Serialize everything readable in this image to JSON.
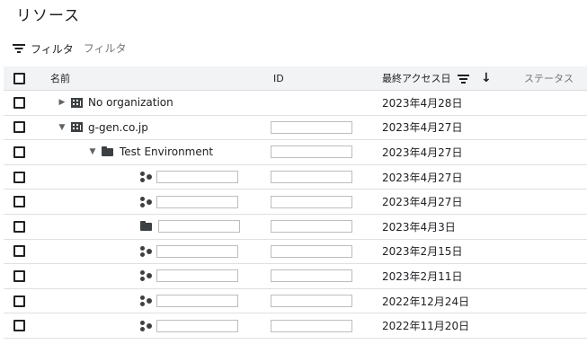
{
  "page": {
    "title": "リソース"
  },
  "filter": {
    "icon": "filter-icon",
    "label": "フィルタ",
    "placeholder": "フィルタ"
  },
  "table": {
    "columns": {
      "name": "名前",
      "id": "ID",
      "last_access": "最終アクセス日",
      "status": "ステータス"
    },
    "sort": {
      "column": "last_access",
      "direction": "descending"
    },
    "rows": [
      {
        "type": "organization",
        "name": "No organization",
        "id": "",
        "last_access": "2023年4月28日",
        "expanded": false
      },
      {
        "type": "organization",
        "name": "g-gen.co.jp",
        "id": "",
        "last_access": "2023年4月27日",
        "expanded": true
      },
      {
        "type": "folder",
        "name": "Test Environment",
        "id": "",
        "last_access": "2023年4月27日",
        "expanded": true
      },
      {
        "type": "project",
        "name": "",
        "id": "",
        "last_access": "2023年4月27日"
      },
      {
        "type": "project",
        "name": "",
        "id": "",
        "last_access": "2023年4月27日"
      },
      {
        "type": "folder",
        "name": "",
        "id": "",
        "last_access": "2023年4月3日"
      },
      {
        "type": "project",
        "name": "",
        "id": "",
        "last_access": "2023年2月15日"
      },
      {
        "type": "project",
        "name": "",
        "id": "",
        "last_access": "2023年2月11日"
      },
      {
        "type": "project",
        "name": "",
        "id": "",
        "last_access": "2022年12月24日"
      },
      {
        "type": "project",
        "name": "",
        "id": "",
        "last_access": "2022年11月20日"
      }
    ]
  }
}
